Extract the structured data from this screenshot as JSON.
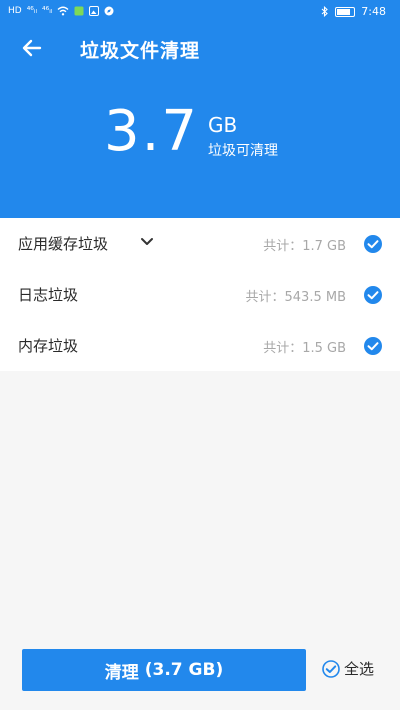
{
  "status_bar": {
    "left_labels": [
      "HD",
      "⁴⁶ᵢₗ",
      "⁴⁶ᵢₗ"
    ],
    "time": "7:48"
  },
  "app_bar": {
    "title": "垃圾文件清理",
    "back_icon": "arrow-left-icon"
  },
  "summary": {
    "size_value": "3.7",
    "size_unit": "GB",
    "caption": "垃圾可清理"
  },
  "items": [
    {
      "name": "应用缓存垃圾",
      "total": "共计：1.7 GB",
      "expandable": true,
      "checked": true
    },
    {
      "name": "日志垃圾",
      "total": "共计：543.5 MB",
      "expandable": false,
      "checked": true
    },
    {
      "name": "内存垃圾",
      "total": "共计：1.5 GB",
      "expandable": false,
      "checked": true
    }
  ],
  "footer": {
    "clean_label": "清理",
    "clean_size": "(3.7 GB)",
    "select_all_label": "全选",
    "select_all_checked": true
  },
  "colors": {
    "primary": "#2288ec",
    "background": "#f6f6f6",
    "muted_text": "#a8a8a8"
  }
}
